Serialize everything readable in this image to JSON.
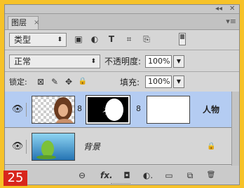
{
  "panel": {
    "collapse_glyph": "◂◂",
    "close_glyph": "✕",
    "tab_label": "图层",
    "tab_close_glyph": "×",
    "menu_glyph": "▾≡"
  },
  "filter": {
    "kind_label": "类型",
    "kind_arrow": "⬍",
    "icons": [
      "image-filter-icon",
      "adjustment-filter-icon",
      "type-filter-icon",
      "shape-filter-icon",
      "smart-object-filter-icon"
    ],
    "icon_glyphs": [
      "▣",
      "◐",
      "T",
      "⌗",
      "⎘"
    ]
  },
  "blend": {
    "mode": "正常",
    "mode_arrow": "⬍",
    "opacity_label": "不透明度:",
    "opacity_value": "100%",
    "dd_glyph": "▼"
  },
  "lock": {
    "label": "锁定:",
    "icon_glyphs": [
      "⊠",
      "✎",
      "✥",
      "🔒"
    ],
    "fill_label": "填充:",
    "fill_value": "100%",
    "dd_glyph": "▼"
  },
  "layers": [
    {
      "name": "人物",
      "eye": "👁",
      "chain": "8",
      "chain2": "8"
    },
    {
      "name": "背景",
      "eye": "👁",
      "lock": "🔒"
    }
  ],
  "bottom": {
    "icon_glyphs": [
      "⊖",
      "fx.",
      "◘",
      "◐.",
      "▭",
      "⧉",
      "🗑"
    ]
  },
  "badge": "25",
  "colors": {
    "selected_row": "#b4ccf2",
    "frame": "#f6c229",
    "badge": "#d8261d"
  }
}
